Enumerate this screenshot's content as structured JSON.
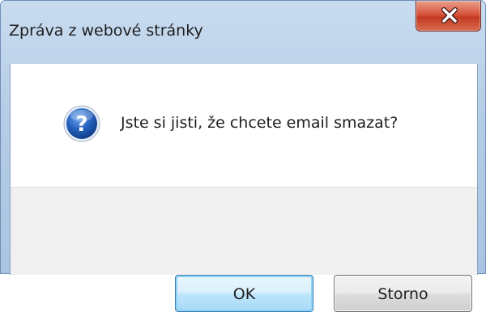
{
  "window": {
    "title": "Zpráva z webové stránky"
  },
  "dialog": {
    "icon": "question-icon",
    "message": "Jste si jisti, že chcete email smazat?"
  },
  "buttons": {
    "ok_label": "OK",
    "cancel_label": "Storno"
  },
  "colors": {
    "frame": "#b6cde6",
    "close_button": "#c23a22",
    "icon_blue": "#1f5fb5",
    "footer_bg": "#f0f0f0"
  }
}
